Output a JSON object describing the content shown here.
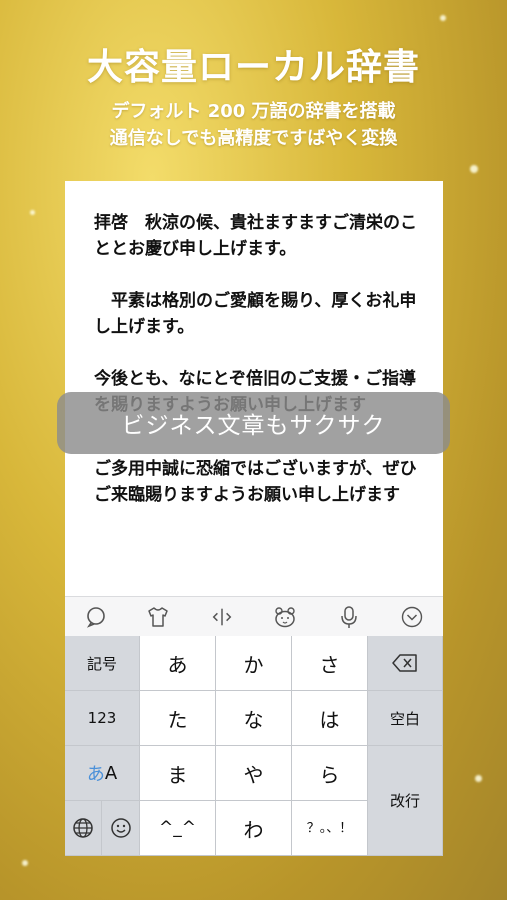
{
  "hero": {
    "title": "大容量ローカル辞書",
    "subtitle_line1": "デフォルト 200 万語の辞書を搭載",
    "subtitle_line2": "通信なしでも高精度ですばやく変換"
  },
  "document": {
    "para1": "拝啓　秋涼の候、貴社ますますご清栄のこととお慶び申し上げます。",
    "para2": "　平素は格別のご愛顧を賜り、厚くお礼申し上げます。",
    "para3": "今後とも、なにとぞ倍旧のご支援・ご指導を賜りますようお願い申し上げます",
    "para4": "ご多用中誠に恐縮ではございますが、ぜひご来臨賜りますようお願い申し上げます"
  },
  "banner": {
    "text": "ビジネス文章もサクサク"
  },
  "toolbar": {
    "icons": [
      "search-icon",
      "tshirt-icon",
      "cursor-icon",
      "bear-icon",
      "mic-icon",
      "chevron-down-icon"
    ]
  },
  "keyboard": {
    "kigou": "記号",
    "num": "123",
    "kana_a": "あ",
    "kana_A": "A",
    "a": "あ",
    "ka": "か",
    "sa": "さ",
    "ta": "た",
    "na": "な",
    "ha": "は",
    "ma": "ま",
    "ya": "や",
    "ra": "ら",
    "emoticon": "^_^",
    "wa": "わ",
    "punct": "？。、！",
    "space": "空白",
    "enter": "改行"
  },
  "colors": {
    "accent_blue": "#4a90d9",
    "gold_bg": "#d8b73a"
  }
}
